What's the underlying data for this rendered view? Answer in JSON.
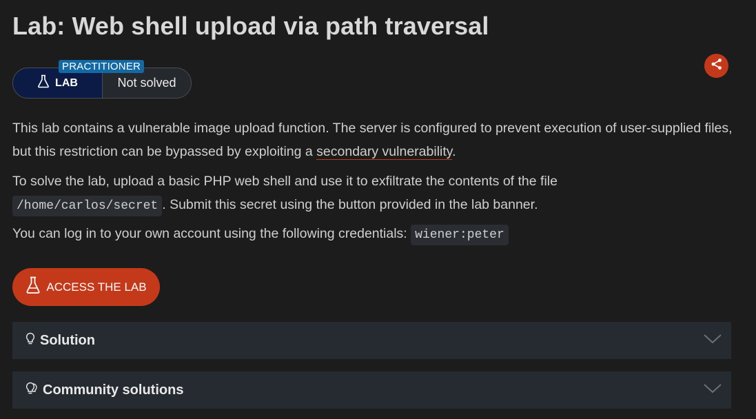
{
  "header": {
    "title": "Lab: Web shell upload via path traversal"
  },
  "badge": {
    "level": "PRACTITIONER",
    "type_label": "LAB",
    "status": "Not solved"
  },
  "description": {
    "p1_text": "This lab contains a vulnerable image upload function. The server is configured to prevent execution of user-supplied files, but this restriction can be bypassed by exploiting a ",
    "p1_link": "secondary vulnerability",
    "p1_end": ".",
    "p2_text": "To solve the lab, upload a basic PHP web shell and use it to exfiltrate the contents of the file ",
    "p2_code": "/home/carlos/secret",
    "p2_end": ". Submit this secret using the button provided in the lab banner.",
    "p3_text": "You can log in to your own account using the following credentials: ",
    "p3_code": "wiener:peter"
  },
  "actions": {
    "access_label": "ACCESS THE LAB"
  },
  "accordions": [
    {
      "label": "Solution",
      "icon": "lightbulb-icon"
    },
    {
      "label": "Community solutions",
      "icon": "lightbulbs-icon"
    }
  ],
  "colors": {
    "accent": "#c5391b",
    "background": "#1c1c1c",
    "lab_badge": "#0b1b45",
    "level_tag": "#1369a4",
    "panel": "#252b30"
  }
}
